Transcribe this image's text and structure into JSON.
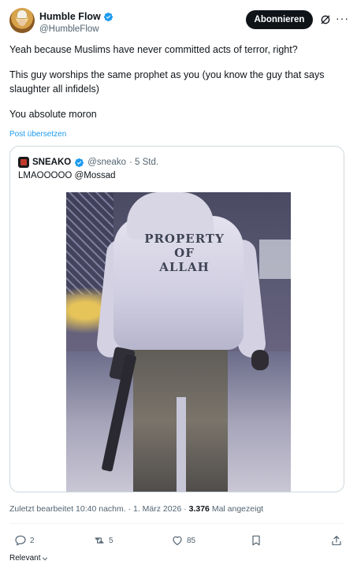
{
  "author": {
    "display_name": "Humble Flow",
    "handle": "@HumbleFlow",
    "verified": true
  },
  "follow_button": "Abonnieren",
  "more_menu_glyph": "···",
  "tweet_paragraphs": [
    "Yeah because Muslims have never committed acts of terror, right?",
    "This guy worships the same prophet as you (you know the guy that says slaughter all infidels)",
    "You absolute moron"
  ],
  "translate_link": "Post übersetzen",
  "quote": {
    "author_name": "SNEAKO",
    "author_handle": "@sneako",
    "time": "· 5 Std.",
    "text": "LMAOOOOO @Mossad",
    "image_text": [
      "PROPERTY",
      "OF",
      "ALLAH"
    ]
  },
  "meta": {
    "edited": "Zuletzt bearbeitet 10:40 nachm. · 1. März 2026 · ",
    "views_count": "3.376",
    "views_label": " Mal angezeigt"
  },
  "actions": {
    "reply_count": "2",
    "retweet_count": "5",
    "like_count": "85"
  },
  "sort_label": "Relevant",
  "colors": {
    "accent": "#1d9bf0",
    "text": "#0f1419",
    "secondary": "#536471",
    "border": "#cfd9de"
  },
  "icons": [
    "verified-badge-icon",
    "grok-icon",
    "more-icon",
    "reply-icon",
    "retweet-icon",
    "like-icon",
    "bookmark-icon",
    "share-icon",
    "chevron-down-icon"
  ]
}
